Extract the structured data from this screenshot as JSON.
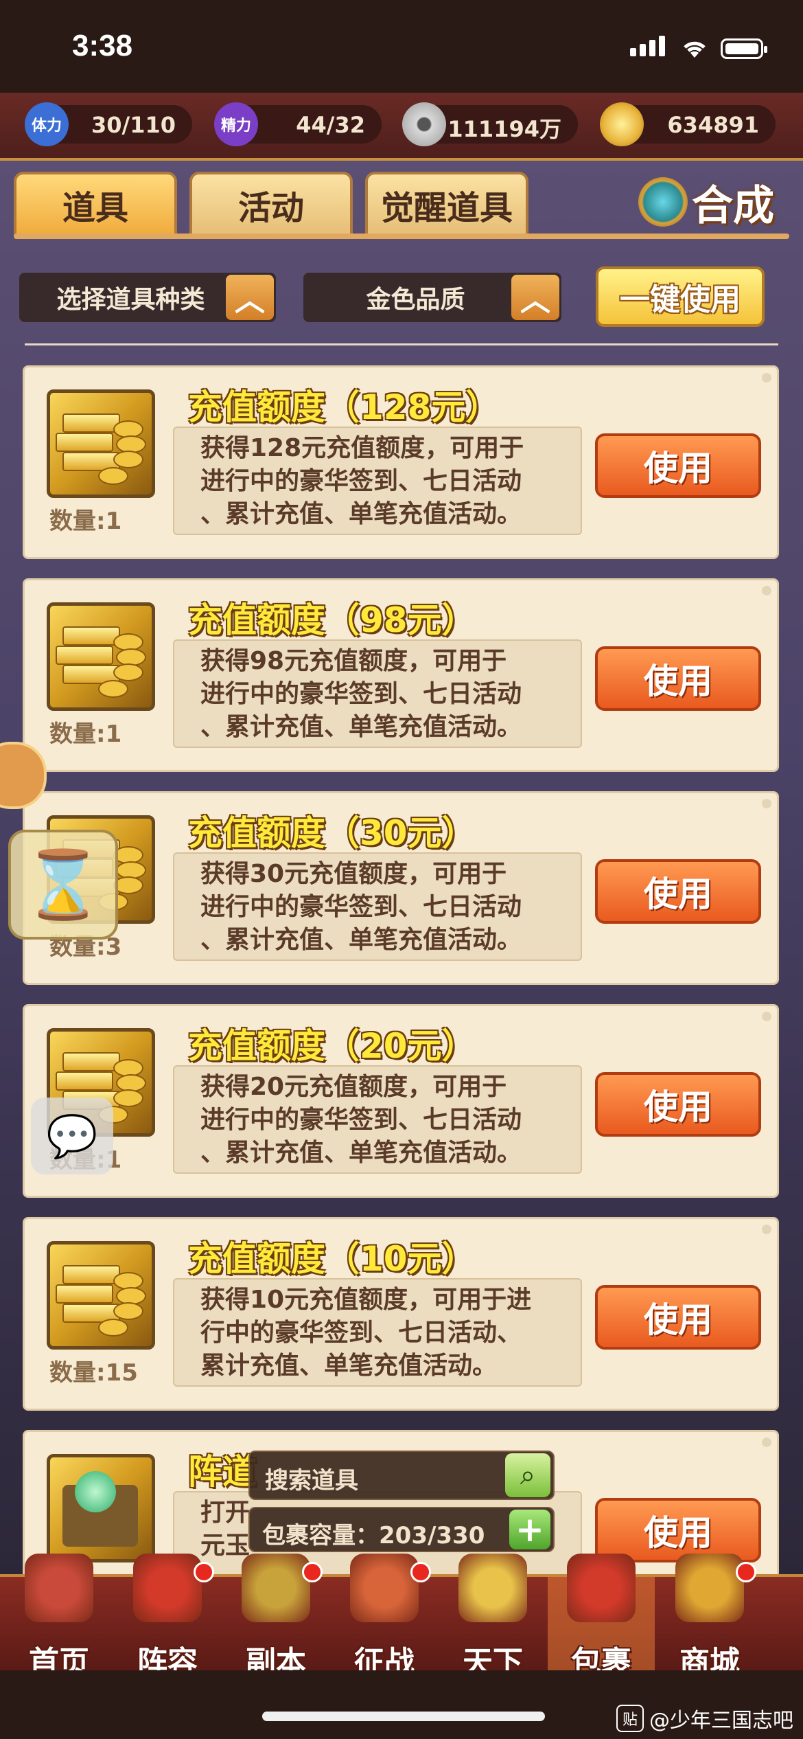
{
  "status_bar": {
    "time": "3:38"
  },
  "resources": [
    {
      "icon_name": "stamina-icon",
      "icon_text": "体力",
      "value": "30/110",
      "color": "#3b6fd6"
    },
    {
      "icon_name": "energy-icon",
      "icon_text": "精力",
      "value": "44/32",
      "color": "#7a3fc6"
    },
    {
      "icon_name": "copper-coin-icon",
      "icon_text": "",
      "value": "111194万",
      "color": "#c9c9c9"
    },
    {
      "icon_name": "gold-ingot-icon",
      "icon_text": "",
      "value": "634891",
      "color": "#e8b33a"
    }
  ],
  "tabs": [
    {
      "label": "道具",
      "active": true
    },
    {
      "label": "活动",
      "active": false
    },
    {
      "label": "觉醒道具",
      "active": false
    }
  ],
  "compose_label": "合成",
  "filters": {
    "type_label": "选择道具种类",
    "quality_label": "金色品质",
    "one_key_use": "一键使用"
  },
  "items": [
    {
      "title": "充值额度（128元）",
      "qty": "数量:1",
      "desc": [
        "获得128元充值额度，可用于",
        "进行中的豪华签到、七日活动",
        "、累计充值、单笔充值活动。"
      ],
      "use": "使用"
    },
    {
      "title": "充值额度（98元）",
      "qty": "数量:1",
      "desc": [
        "获得98元充值额度，可用于",
        "进行中的豪华签到、七日活动",
        "、累计充值、单笔充值活动。"
      ],
      "use": "使用"
    },
    {
      "title": "充值额度（30元）",
      "qty": "数量:3",
      "desc": [
        "获得30元充值额度，可用于",
        "进行中的豪华签到、七日活动",
        "、累计充值、单笔充值活动。"
      ],
      "use": "使用"
    },
    {
      "title": "充值额度（20元）",
      "qty": "数量:1",
      "desc": [
        "获得20元充值额度，可用于",
        "进行中的豪华签到、七日活动",
        "、累计充值、单笔充值活动。"
      ],
      "use": "使用"
    },
    {
      "title": "充值额度（10元）",
      "qty": "数量:15",
      "desc": [
        "获得10元充值额度，可用于进",
        "行中的豪华签到、七日活动、",
        "累计充值、单笔充值活动。"
      ],
      "use": "使用"
    },
    {
      "title": "阵道",
      "qty": "",
      "desc": [
        "打开",
        "元玉"
      ],
      "use": "使用"
    }
  ],
  "search": {
    "placeholder": "搜索道具"
  },
  "capacity": {
    "label": "包裹容量：203/330"
  },
  "nav": [
    {
      "label": "首页",
      "icon": "home-icon",
      "badge": false,
      "active": false,
      "color": "#c94a3a"
    },
    {
      "label": "阵容",
      "icon": "lineup-icon",
      "badge": true,
      "active": false,
      "color": "#d33a2a"
    },
    {
      "label": "副本",
      "icon": "dungeon-icon",
      "badge": true,
      "active": false,
      "color": "#c8a23a"
    },
    {
      "label": "征战",
      "icon": "battle-icon",
      "badge": true,
      "active": false,
      "color": "#d8653a"
    },
    {
      "label": "天下",
      "icon": "world-icon",
      "badge": false,
      "active": false,
      "color": "#e8c24a"
    },
    {
      "label": "包裹",
      "icon": "bag-icon",
      "badge": false,
      "active": true,
      "color": "#d23a2a"
    },
    {
      "label": "商城",
      "icon": "shop-icon",
      "badge": true,
      "active": false,
      "color": "#e0a832"
    }
  ],
  "watermark": "@少年三国志吧"
}
